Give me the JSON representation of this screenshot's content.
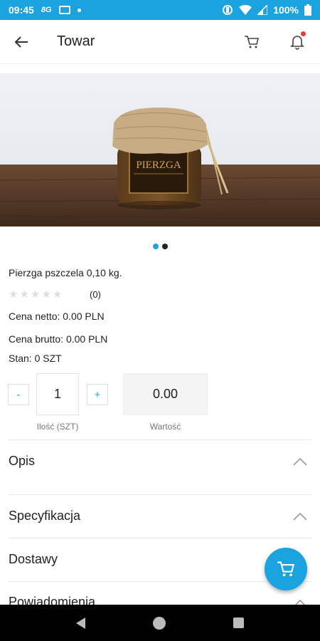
{
  "status_bar": {
    "time": "09:45",
    "carrier_badge": "8G",
    "battery": "100%"
  },
  "app_bar": {
    "title": "Towar",
    "icons": [
      "back-arrow-icon",
      "cart-icon",
      "bell-icon"
    ]
  },
  "gallery": {
    "jar_label": "PIERZGA",
    "image_count": 2,
    "active_index": 0
  },
  "product": {
    "name": "Pierzga pszczela 0,10 kg.",
    "rating_stars": 0,
    "reviews": "(0)",
    "price_net": "Cena netto: 0.00 PLN",
    "price_gross": "Cena brutto: 0.00 PLN",
    "stock": "Stan: 0 SZT"
  },
  "quantity": {
    "minus_label": "-",
    "plus_label": "+",
    "value": "1",
    "label": "Ilość (SZT)"
  },
  "total": {
    "value": "0.00",
    "label": "Wartość"
  },
  "sections": [
    {
      "label": "Opis"
    },
    {
      "label": "Specyfikacja"
    },
    {
      "label": "Dostawy"
    },
    {
      "label": "Powiadomienia"
    }
  ],
  "colors": {
    "accent": "#1ba3e0",
    "notification": "#e53935"
  }
}
